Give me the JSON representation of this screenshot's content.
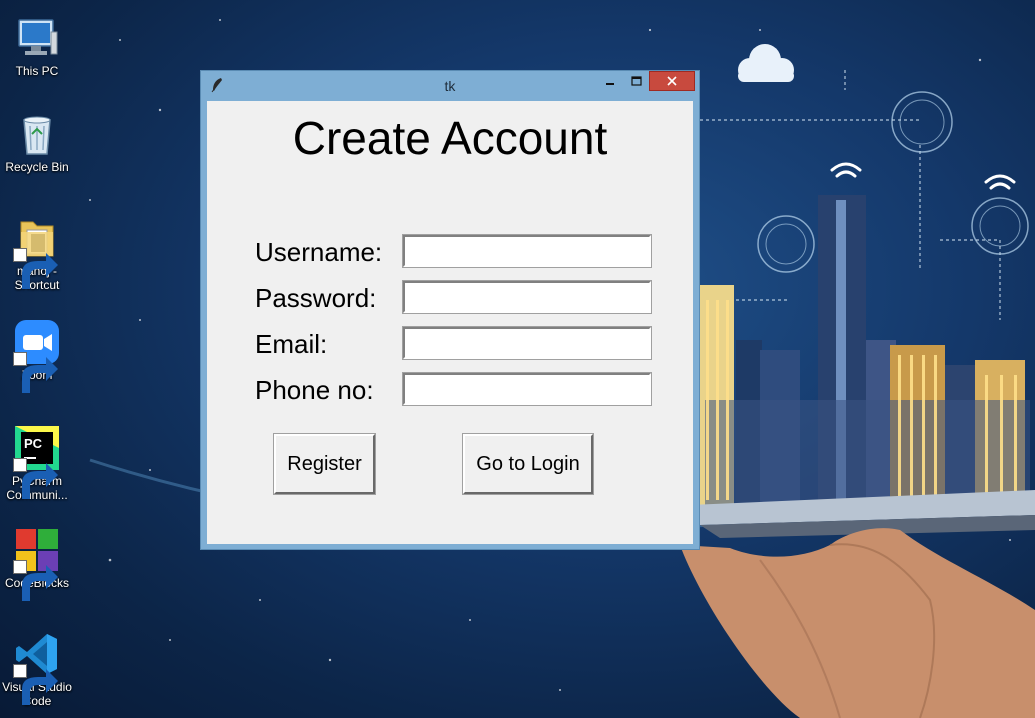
{
  "desktop": {
    "icons": [
      {
        "label": "This PC",
        "icon": "computer-icon",
        "shortcut": false
      },
      {
        "label": "Recycle Bin",
        "icon": "recycle-bin-icon",
        "shortcut": false
      },
      {
        "label": "manoj - Shortcut",
        "icon": "folder-icon",
        "shortcut": true
      },
      {
        "label": "Zoom",
        "icon": "zoom-icon",
        "shortcut": true
      },
      {
        "label": "PyCharm Communi...",
        "icon": "pycharm-icon",
        "shortcut": true
      },
      {
        "label": "CodeBlocks",
        "icon": "codeblocks-icon",
        "shortcut": true
      },
      {
        "label": "Visual Studio Code",
        "icon": "vscode-icon",
        "shortcut": true
      }
    ]
  },
  "window": {
    "title": "tk",
    "icon": "feather-icon",
    "controls": [
      "minimize-icon",
      "maximize-icon",
      "close-icon"
    ],
    "accent": "#7eaed4",
    "close_color": "#c84a3e"
  },
  "form": {
    "heading": "Create Account",
    "fields": [
      {
        "label": "Username:",
        "value": ""
      },
      {
        "label": "Password:",
        "value": ""
      },
      {
        "label": "Email:",
        "value": ""
      },
      {
        "label": "Phone no:",
        "value": ""
      }
    ],
    "register_label": "Register",
    "login_label": "Go to Login"
  }
}
